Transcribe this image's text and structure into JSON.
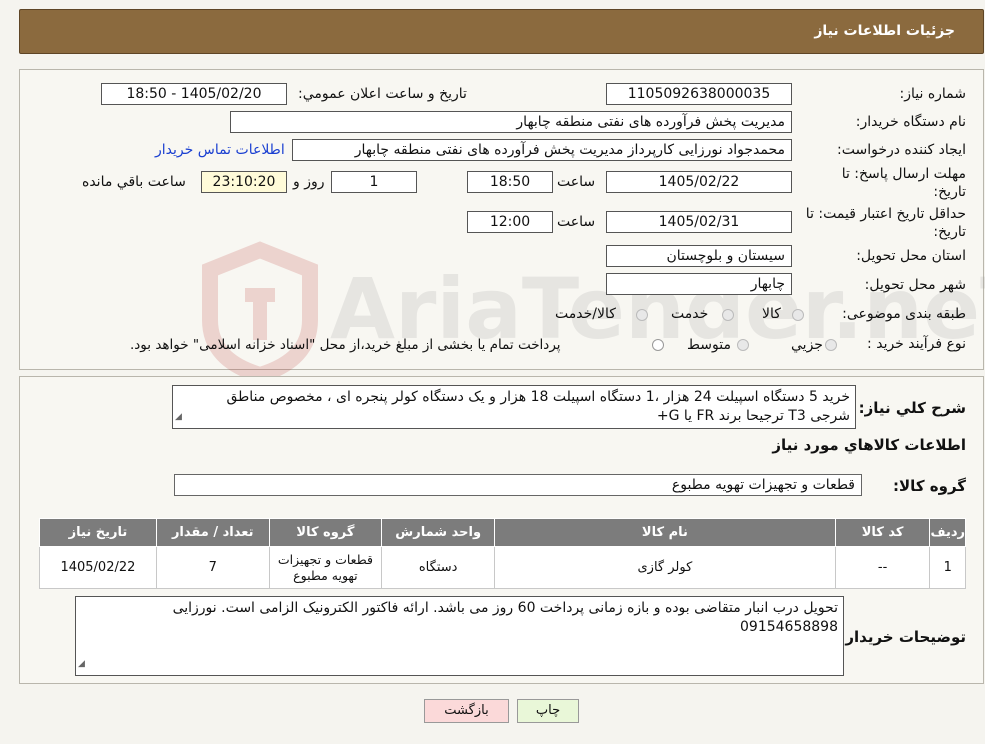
{
  "header": {
    "title": "جزئیات اطلاعات نیاز"
  },
  "watermark": {
    "text": "AriaTender.neT"
  },
  "form": {
    "need_number_label": "شماره نیاز:",
    "need_number": "1105092638000035",
    "announce_label": "تاریخ و ساعت اعلان عمومي:",
    "announce_value": "1405/02/20 - 18:50",
    "buyer_org_label": "نام دستگاه خریدار:",
    "buyer_org": "مدیریت پخش فرآورده های نفتی منطقه چابهار",
    "creator_label": "ایجاد کننده درخواست:",
    "creator": "محمدجواد نورزایی کارپرداز مدیریت پخش فرآورده های نفتی منطقه چابهار",
    "contact_link": "اطلاعات تماس خریدار",
    "send_deadline_label_1": "مهلت ارسال پاسخ: تا",
    "send_deadline_label_2": "تاریخ:",
    "send_deadline_date": "1405/02/22",
    "time_label": "ساعت",
    "send_deadline_time": "18:50",
    "days_value": "1",
    "days_label": "روز و",
    "remaining_time": "23:10:20",
    "remaining_label": "ساعت باقي مانده",
    "validity_label_1": "حداقل تاریخ اعتبار قیمت: تا",
    "validity_label_2": "تاریخ:",
    "validity_date": "1405/02/31",
    "validity_time": "12:00",
    "province_label": "استان محل تحویل:",
    "province": "سیستان و بلوچستان",
    "city_label": "شهر محل تحویل:",
    "city": "چابهار",
    "category_label": "طبقه بندی موضوعی:",
    "category_options": [
      "کالا",
      "خدمت",
      "کالا/خدمت"
    ],
    "purchase_type_label": "نوع فرآیند خرید :",
    "purchase_options": [
      "جزيي",
      "متوسط"
    ],
    "purchase_note": "پرداخت تمام یا بخشی از مبلغ خرید،از محل \"اسناد خزانه اسلامی\" خواهد بود."
  },
  "summary": {
    "label": "شرح کلي نياز:",
    "text_line1": "خرید 5 دستگاه اسپیلت 24 هزار ،1 دستگاه اسپیلت 18 هزار و یک دستگاه کولر پنجره ای ، مخصوص مناطق",
    "text_line2": "شرجی  T3  ترجیحا برند FR  یا  G+",
    "goods_info_title": "اطلاعات کالاهاي مورد نياز",
    "group_label": "گروه کالا:",
    "group_value": "قطعات و تجهیزات تهویه مطبوع"
  },
  "table": {
    "headers": [
      "رديف",
      "کد کالا",
      "نام کالا",
      "واحد شمارش",
      "گروه کالا",
      "تعداد / مقدار",
      "تاریخ نیاز"
    ],
    "rows": [
      [
        "1",
        "--",
        "کولر گازی",
        "دستگاه",
        "قطعات و تجهیزات تهویه مطبوع",
        "7",
        "1405/02/22"
      ]
    ]
  },
  "buyer_notes": {
    "label": "توضیحات خریدار:",
    "text_line1": "تحویل درب انبار متقاضی بوده و بازه زمانی پرداخت 60 روز می باشد. ارائه فاکتور الکترونیک الزامی است. نورزایی",
    "text_line2": "09154658898"
  },
  "buttons": {
    "print": "چاپ",
    "back": "بازگشت"
  }
}
